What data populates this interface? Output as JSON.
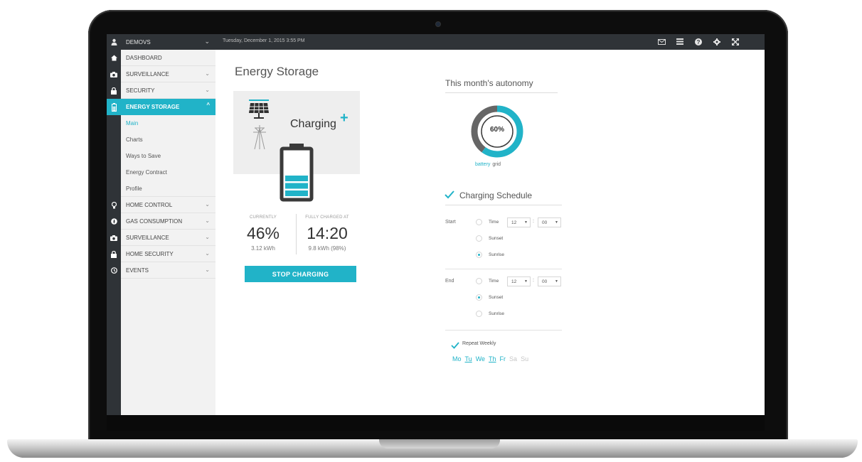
{
  "topbar": {
    "user": "DEMOVS",
    "datetime": "Tuesday, December 1, 2015 3:55 PM",
    "icons": [
      "mail-icon",
      "list-icon",
      "help-icon",
      "settings-icon",
      "fullscreen-icon"
    ]
  },
  "sidebar": {
    "items": [
      {
        "label": "DASHBOARD",
        "icon": "home-icon"
      },
      {
        "label": "SURVEILLANCE",
        "icon": "camera-icon"
      },
      {
        "label": "SECURITY",
        "icon": "lock-icon"
      },
      {
        "label": "ENERGY STORAGE",
        "icon": "battery-icon",
        "active": true
      },
      {
        "label": "HOME CONTROL",
        "icon": "bulb-icon"
      },
      {
        "label": "GAS CONSUMPTION",
        "icon": "flame-icon"
      },
      {
        "label": "SURVEILLANCE",
        "icon": "camera-icon"
      },
      {
        "label": "HOME SECURITY",
        "icon": "lock-icon"
      },
      {
        "label": "EVENTS",
        "icon": "clock-icon"
      }
    ],
    "subitems": [
      "Main",
      "Charts",
      "Ways to Save",
      "Energy Contract",
      "Profile"
    ]
  },
  "main": {
    "title": "Energy Storage",
    "status": "Charging",
    "currently_label": "CURRENTLY",
    "currently_value": "46%",
    "currently_kwh": "3.12 kWh",
    "full_label": "FULLY CHARGED AT",
    "full_value": "14:20",
    "full_kwh": "9.8 kWh (98%)",
    "stop_button": "STOP CHARGING",
    "battery_level": 0.46
  },
  "autonomy": {
    "title": "This month's autonomy",
    "percent_label": "60%",
    "battery_fraction": 0.6,
    "legend_battery": "battery",
    "legend_grid": "grid",
    "color_battery": "#21b3c8",
    "color_grid": "#666666"
  },
  "schedule": {
    "title": "Charging Schedule",
    "start_label": "Start",
    "end_label": "End",
    "time_label": "Time",
    "sunset_label": "Sunset",
    "sunrise_label": "Sunrise",
    "start_hour": "12",
    "start_min": "00",
    "end_hour": "12",
    "end_min": "00",
    "start_selected": "Sunrise",
    "end_selected": "Sunset",
    "colon": ":",
    "repeat_label": "Repeat Weekly",
    "days": [
      {
        "label": "Mo",
        "on": true,
        "underline": false
      },
      {
        "label": "Tu",
        "on": true,
        "underline": true
      },
      {
        "label": "We",
        "on": true,
        "underline": false
      },
      {
        "label": "Th",
        "on": true,
        "underline": true
      },
      {
        "label": "Fr",
        "on": true,
        "underline": false
      },
      {
        "label": "Sa",
        "on": false,
        "underline": false
      },
      {
        "label": "Su",
        "on": false,
        "underline": false
      }
    ]
  },
  "accent_color": "#21b3c8"
}
